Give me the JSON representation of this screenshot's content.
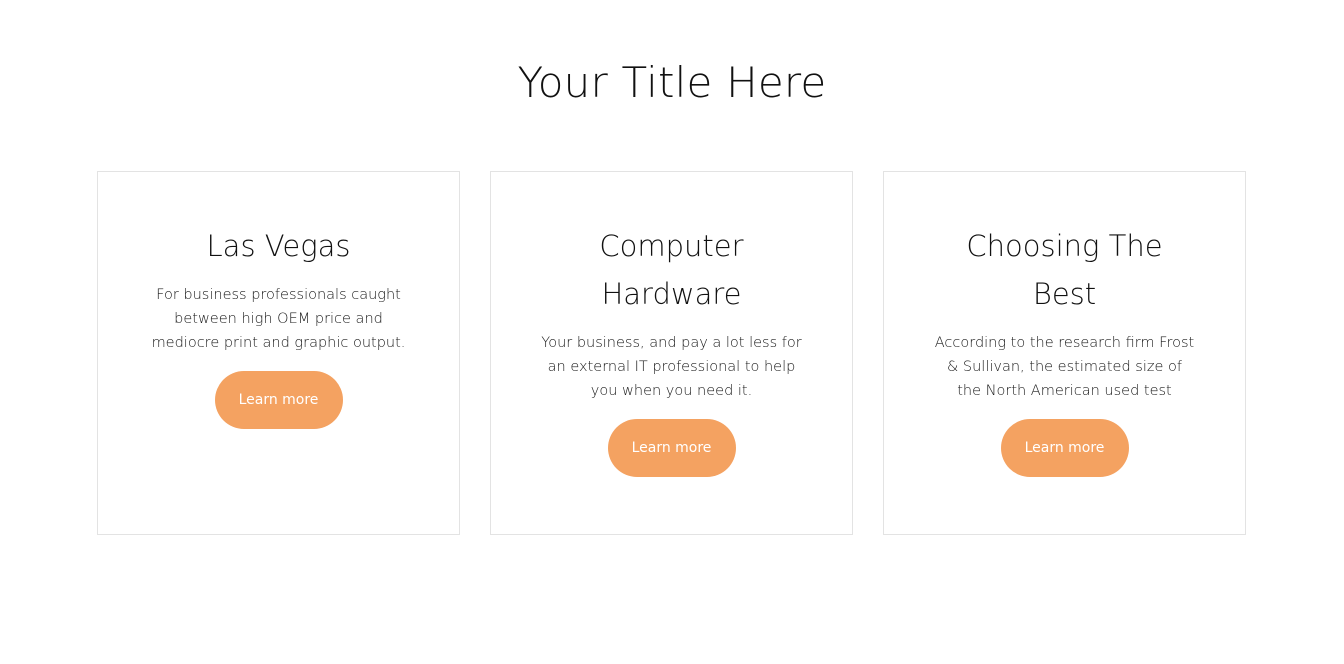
{
  "page": {
    "title": "Your Title Here"
  },
  "colors": {
    "accent": "#f4a261",
    "border": "#e3e3e3",
    "text": "#111111",
    "background": "#ffffff"
  },
  "cards": [
    {
      "title": "Las Vegas",
      "text": "For business professionals caught between high OEM price and mediocre print and graphic output.",
      "button_label": "Learn more"
    },
    {
      "title": "Computer Hardware",
      "text": "Your business, and pay a lot less for an external IT professional to help you when you need it.",
      "button_label": "Learn more"
    },
    {
      "title": "Choosing The Best",
      "text": "According to the research firm Frost & Sullivan, the estimated size of the North American used test",
      "button_label": "Learn more"
    }
  ]
}
